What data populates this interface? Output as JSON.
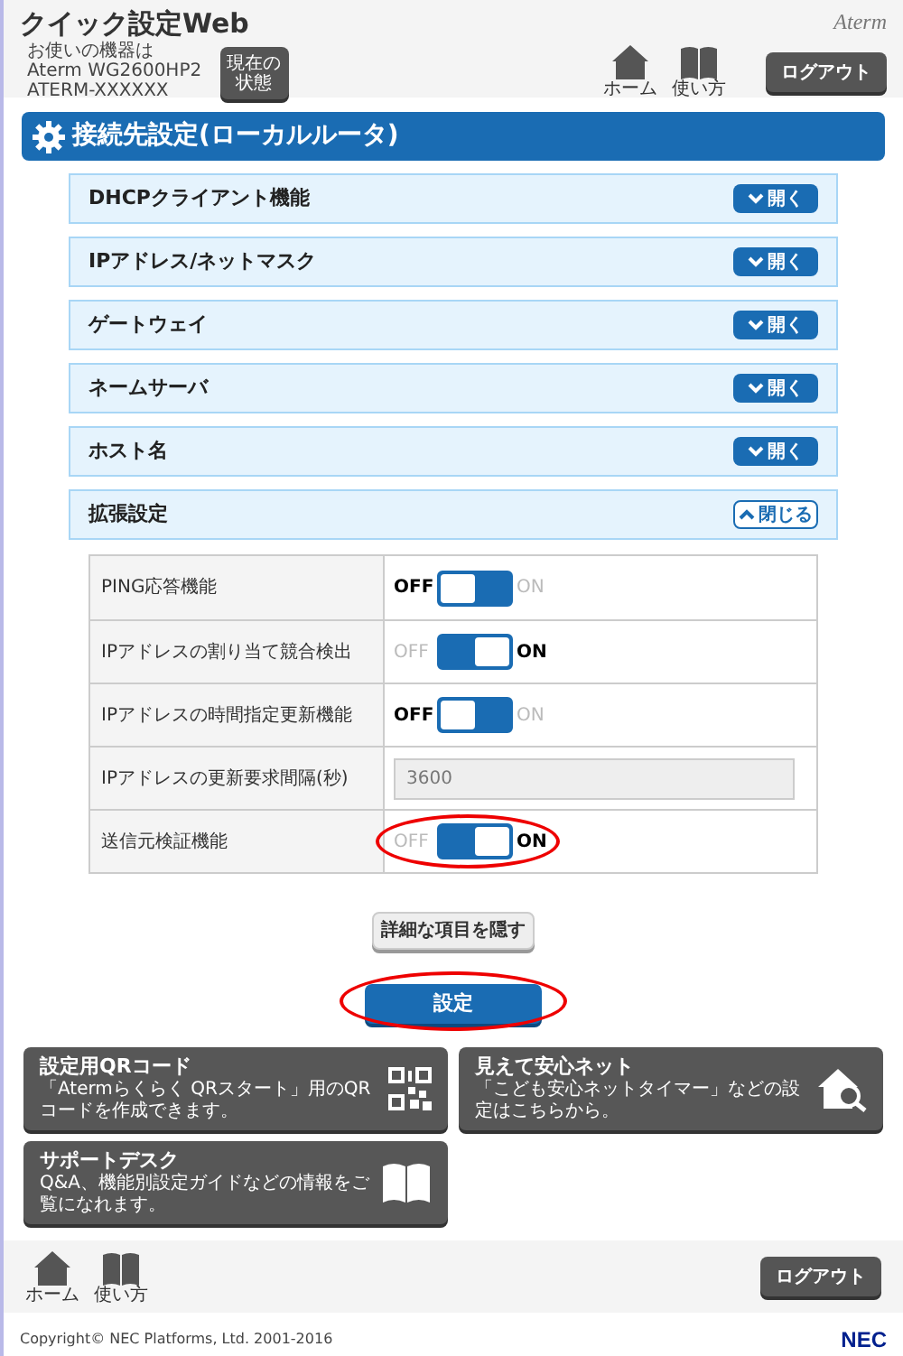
{
  "header": {
    "app_title": "クイック設定Web",
    "device_lines": [
      "お使いの機器は",
      "Aterm WG2600HP2",
      "ATERM-XXXXXX"
    ],
    "status_button": [
      "現在の",
      "状態"
    ],
    "brand": "Aterm",
    "home_label": "ホーム",
    "guide_label": "使い方",
    "logout": "ログアウト"
  },
  "section_title": "接続先設定(ローカルルータ)",
  "accordion": [
    {
      "title": "DHCPクライアント機能",
      "expanded": false,
      "toggle": "開く"
    },
    {
      "title": "IPアドレス/ネットマスク",
      "expanded": false,
      "toggle": "開く"
    },
    {
      "title": "ゲートウェイ",
      "expanded": false,
      "toggle": "開く"
    },
    {
      "title": "ネームサーバ",
      "expanded": false,
      "toggle": "開く"
    },
    {
      "title": "ホスト名",
      "expanded": false,
      "toggle": "開く"
    },
    {
      "title": "拡張設定",
      "expanded": true,
      "toggle": "閉じる"
    }
  ],
  "settings": [
    {
      "kind": "toggle",
      "label": "PING応答機能",
      "on": false,
      "off_text": "OFF",
      "on_text": "ON",
      "highlighted": false
    },
    {
      "kind": "toggle",
      "label": "IPアドレスの割り当て競合検出",
      "on": true,
      "off_text": "OFF",
      "on_text": "ON",
      "highlighted": false
    },
    {
      "kind": "toggle",
      "label": "IPアドレスの時間指定更新機能",
      "on": false,
      "off_text": "OFF",
      "on_text": "ON",
      "highlighted": false
    },
    {
      "kind": "input",
      "label": "IPアドレスの更新要求間隔(秒)",
      "value": "3600",
      "disabled": true
    },
    {
      "kind": "toggle",
      "label": "送信元検証機能",
      "on": true,
      "off_text": "OFF",
      "on_text": "ON",
      "highlighted": true
    }
  ],
  "hide_details_button": "詳細な項目を隠す",
  "submit": {
    "label": "設定",
    "highlighted": true
  },
  "cards": [
    {
      "kind": "qr",
      "title": "設定用QRコード",
      "description": "「Atermらくらく QRスタート」用のQRコードを作成できます。"
    },
    {
      "kind": "house",
      "title": "見えて安心ネット",
      "description": "「こども安心ネットタイマー」などの設定はこちらから。"
    },
    {
      "kind": "book",
      "title": "サポートデスク",
      "description": "Q&A、機能別設定ガイドなどの情報をご覧になれます。"
    }
  ],
  "footer": {
    "home_label": "ホーム",
    "guide_label": "使い方",
    "logout": "ログアウト",
    "copyright": "Copyright© NEC Platforms, Ltd. 2001-2016",
    "logo": "NEC"
  }
}
